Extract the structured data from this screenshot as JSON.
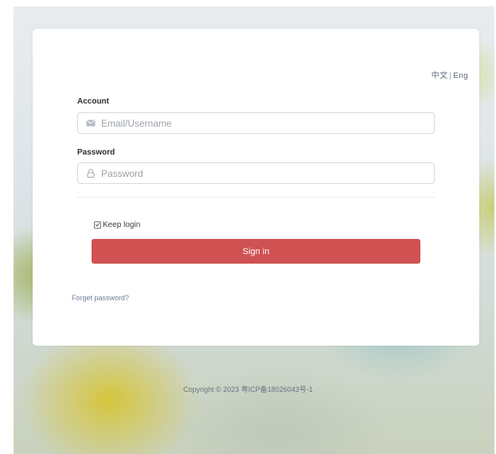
{
  "language_switch": {
    "chinese": "中文",
    "separator": "|",
    "english": "Eng"
  },
  "account": {
    "label": "Account",
    "placeholder": "Email/Username",
    "icon": "envelope-icon"
  },
  "password": {
    "label": "Password",
    "placeholder": "Password",
    "icon": "lock-icon"
  },
  "keep_login": {
    "label": "Keep login",
    "checked": true
  },
  "signin_button": {
    "label": "Sign in",
    "color": "#cf5151"
  },
  "forgot_password": "Forget password?",
  "footer": {
    "copyright": "Copyright © 2023 粤ICP备18026043号-1"
  }
}
